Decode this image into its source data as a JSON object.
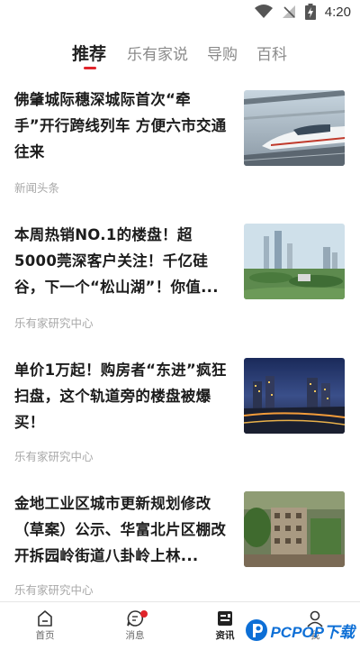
{
  "status_bar": {
    "time": "4:20"
  },
  "tabs": [
    {
      "label": "推荐"
    },
    {
      "label": "乐有家说"
    },
    {
      "label": "导购"
    },
    {
      "label": "百科"
    }
  ],
  "articles": [
    {
      "title": "佛肇城际穗深城际首次“牵手”开行跨线列车 方便六市交通往来",
      "source": "新闻头条",
      "image": "high-speed-train"
    },
    {
      "title": "本周热销NO.1的楼盘！超5000莞深客户关注！千亿硅谷，下一个“松山湖”！你值...",
      "source": "乐有家研究中心",
      "image": "city-skyline"
    },
    {
      "title": "单价1万起！购房者“东进”疯狂扫盘，这个轨道旁的楼盘被爆买！",
      "source": "乐有家研究中心",
      "image": "night-city"
    },
    {
      "title": "金地工业区城市更新规划修改（草案）公示、华富北片区棚改开拆园岭街道八卦岭上林...",
      "source": "乐有家研究中心",
      "image": "old-buildings"
    }
  ],
  "bottom_nav": [
    {
      "label": "首页",
      "icon": "home-icon"
    },
    {
      "label": "消息",
      "icon": "message-icon"
    },
    {
      "label": "资讯",
      "icon": "news-icon"
    },
    {
      "label": "我",
      "icon": "person-icon"
    }
  ],
  "watermark": {
    "text": "PCPOP下载"
  },
  "colors": {
    "accent": "#e0242b",
    "text": "#1c1c1c",
    "muted": "#a8a8a8"
  }
}
